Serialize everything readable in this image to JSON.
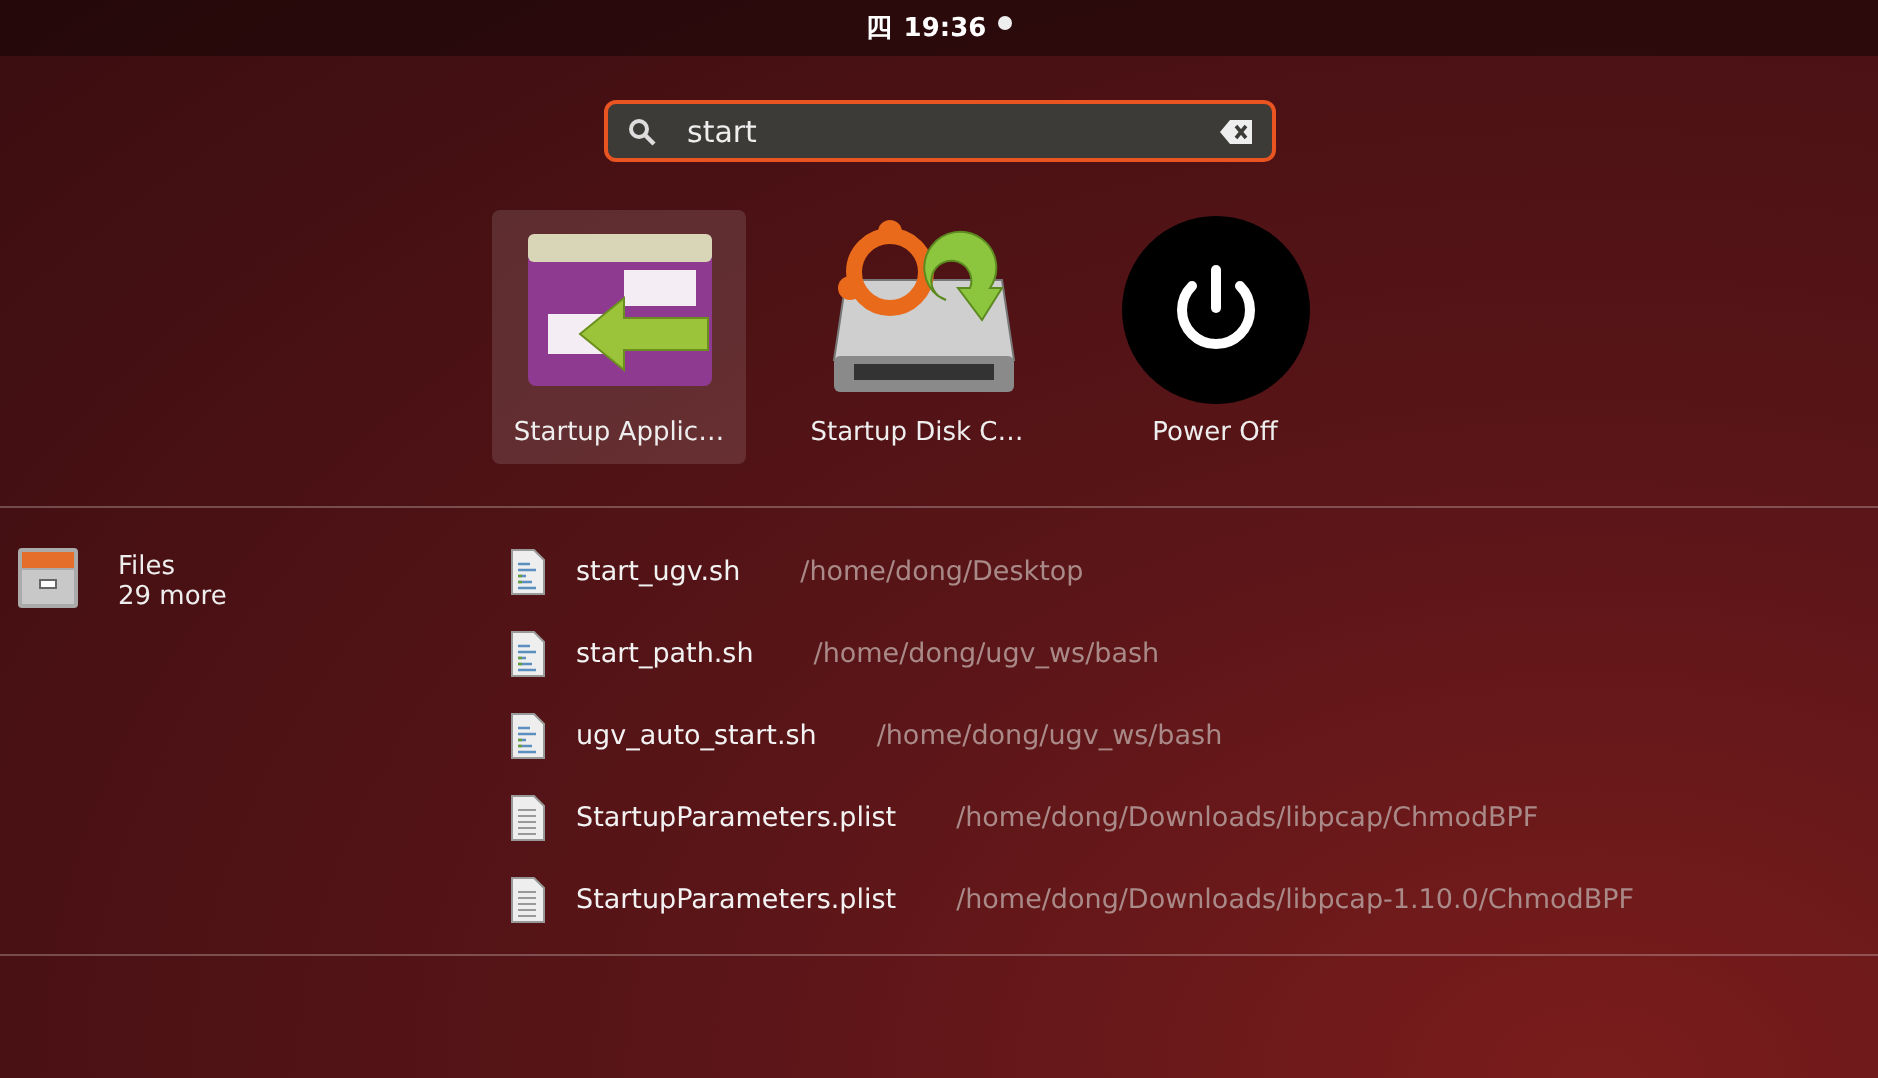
{
  "top_bar": {
    "day": "四",
    "time": "19:36"
  },
  "search": {
    "value": "start"
  },
  "apps": [
    {
      "name": "Startup Applic…",
      "kind": "startup-apps",
      "selected": true
    },
    {
      "name": "Startup Disk C…",
      "kind": "startup-disk",
      "selected": false
    },
    {
      "name": "Power Off",
      "kind": "power",
      "selected": false
    }
  ],
  "provider": {
    "name": "Files",
    "more": "29 more"
  },
  "files": [
    {
      "name": "start_ugv.sh",
      "path": "/home/dong/Desktop",
      "kind": "script"
    },
    {
      "name": "start_path.sh",
      "path": "/home/dong/ugv_ws/bash",
      "kind": "script"
    },
    {
      "name": "ugv_auto_start.sh",
      "path": "/home/dong/ugv_ws/bash",
      "kind": "script"
    },
    {
      "name": "StartupParameters.plist",
      "path": "/home/dong/Downloads/libpcap/ChmodBPF",
      "kind": "text"
    },
    {
      "name": "StartupParameters.plist",
      "path": "/home/dong/Downloads/libpcap-1.10.0/ChmodBPF",
      "kind": "text"
    }
  ]
}
